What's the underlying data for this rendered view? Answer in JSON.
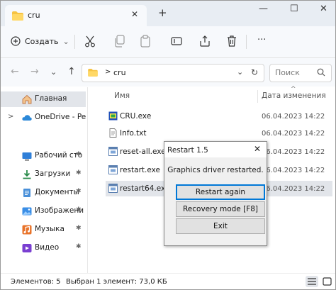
{
  "window": {
    "tab_title": "cru",
    "new_tab": "+",
    "minimize": "—",
    "maximize": "☐",
    "close": "✕",
    "tab_close": "✕"
  },
  "toolbar": {
    "create_label": "Создать",
    "create_plus": "+",
    "create_chev": "⌄",
    "more": "···"
  },
  "nav": {
    "back": "←",
    "forward": "→",
    "down": "⌄",
    "up": "↑",
    "breadcrumb_sep": ">",
    "crumb": "cru",
    "addr_dropdown": "⌄",
    "refresh": "↻",
    "search_placeholder": "Поиск"
  },
  "sidebar": {
    "items": [
      {
        "label": "Главная",
        "icon": "home-icon",
        "selected": true,
        "expander": ""
      },
      {
        "label": "OneDrive - Pers",
        "icon": "cloud-icon",
        "selected": false,
        "expander": ">"
      },
      {
        "label": "Рабочий сто",
        "icon": "desktop-icon",
        "pin": true
      },
      {
        "label": "Загрузки",
        "icon": "download-icon",
        "pin": true
      },
      {
        "label": "Документы",
        "icon": "documents-icon",
        "pin": true
      },
      {
        "label": "Изображени",
        "icon": "pictures-icon",
        "pin": true
      },
      {
        "label": "Музыка",
        "icon": "music-icon",
        "pin": true
      },
      {
        "label": "Видео",
        "icon": "video-icon",
        "pin": true
      }
    ],
    "pin_glyph": "📌"
  },
  "filelist": {
    "col_name": "Имя",
    "col_date": "Дата изменения",
    "sort_chev": "^",
    "files": [
      {
        "name": "CRU.exe",
        "date": "06.04.2023 14:22",
        "icon": "exe-icon",
        "selected": false
      },
      {
        "name": "Info.txt",
        "date": "06.04.2023 14:22",
        "icon": "text-file-icon",
        "selected": false
      },
      {
        "name": "reset-all.exe",
        "date": "06.04.2023 14:22",
        "icon": "exe-icon",
        "selected": false
      },
      {
        "name": "restart.exe",
        "date": "06.04.2023 14:22",
        "icon": "exe-icon",
        "selected": false
      },
      {
        "name": "restart64.exe",
        "date": "06.04.2023 14:22",
        "icon": "exe-icon",
        "selected": true
      }
    ]
  },
  "status": {
    "items_count": "Элементов: 5",
    "selection": "Выбран 1 элемент: 73,0 КБ"
  },
  "dialog": {
    "title": "Restart 1.5",
    "close": "✕",
    "message": "Graphics driver restarted.",
    "btn_restart_again": "Restart again",
    "btn_recovery": "Recovery mode [F8]",
    "btn_exit": "Exit"
  },
  "colors": {
    "folder": "#f6c343",
    "accent": "#0078d7",
    "selection": "#e2e5ea"
  }
}
